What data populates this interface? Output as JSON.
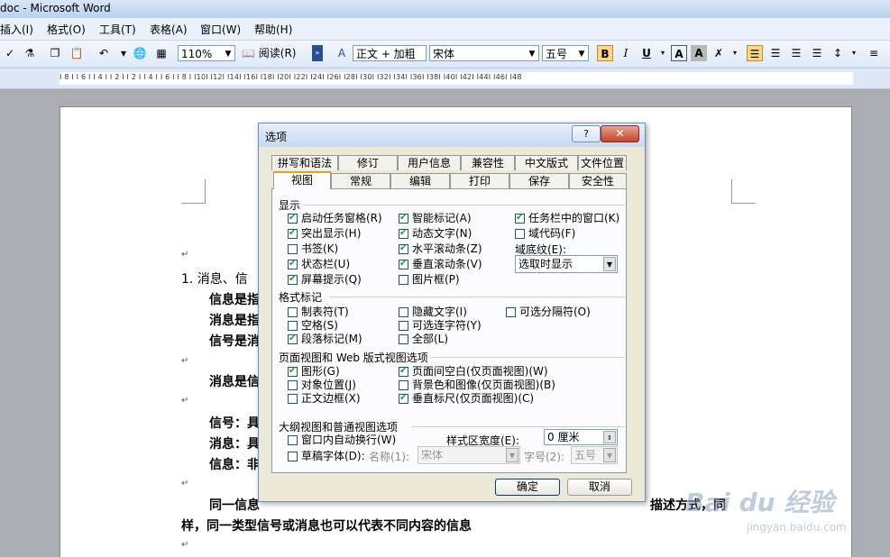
{
  "window": {
    "title": "doc - Microsoft Word"
  },
  "menu": [
    "插入(I)",
    "格式(O)",
    "工具(T)",
    "表格(A)",
    "窗口(W)",
    "帮助(H)"
  ],
  "toolbar": {
    "zoom": "110%",
    "read_label": "阅读(R)",
    "style": "正文 + 加粗",
    "font": "宋体",
    "size": "五号",
    "bold": "B",
    "italic": "I",
    "underline": "U",
    "font_color": "A",
    "char_shade": "A"
  },
  "ruler": {
    "marks": "I 8 I  I 6 I  I 4 I  I 2 I       I 2 I  I 4 I  I 6 I  I 8 I  I10I  I12I  I14I  I16I  I18I  I20I  I22I  I24I  I26I  I28I  I30I  I32I  I34I  I36I  I38I  I40I  I42I  I44I  I46I  I48"
  },
  "document": {
    "line1_prefix": "1. 消息、信",
    "line2": "信息是指",
    "line3": "消息是指",
    "line4": "信号是消",
    "line5": "消息是信",
    "line6": "信号：具",
    "line7": "消息：具",
    "line8": "信息：非",
    "line9_start": "同一信息",
    "line9_end": "描述方式，同",
    "line10": "样，同一类型信号或消息也可以代表不同内容的信息",
    "para_mark": "↵"
  },
  "dialog": {
    "title": "选项",
    "help": "?",
    "close": "✕",
    "tabs_back": [
      "拼写和语法",
      "修订",
      "用户信息",
      "兼容性",
      "中文版式",
      "文件位置"
    ],
    "tabs_front": [
      "视图",
      "常规",
      "编辑",
      "打印",
      "保存",
      "安全性"
    ],
    "show_group": "显示",
    "show_items": [
      {
        "label": "启动任务窗格(R)",
        "checked": true
      },
      {
        "label": "智能标记(A)",
        "checked": true
      },
      {
        "label": "任务栏中的窗口(K)",
        "checked": true
      },
      {
        "label": "突出显示(H)",
        "checked": true
      },
      {
        "label": "动态文字(N)",
        "checked": true
      },
      {
        "label": "域代码(F)",
        "checked": false
      },
      {
        "label": "书签(K)",
        "checked": false
      },
      {
        "label": "水平滚动条(Z)",
        "checked": true
      },
      {
        "label": "状态栏(U)",
        "checked": true
      },
      {
        "label": "垂直滚动条(V)",
        "checked": true
      },
      {
        "label": "屏幕提示(Q)",
        "checked": true
      },
      {
        "label": "图片框(P)",
        "checked": false
      }
    ],
    "field_shading_label": "域底纹(E):",
    "field_shading_value": "选取时显示",
    "format_group": "格式标记",
    "format_items": [
      {
        "label": "制表符(T)",
        "checked": false
      },
      {
        "label": "隐藏文字(I)",
        "checked": false
      },
      {
        "label": "可选分隔符(O)",
        "checked": false
      },
      {
        "label": "空格(S)",
        "checked": false
      },
      {
        "label": "可选连字符(Y)",
        "checked": false
      },
      {
        "label": "段落标记(M)",
        "checked": true
      },
      {
        "label": "全部(L)",
        "checked": false
      }
    ],
    "page_group": "页面视图和 Web 版式视图选项",
    "page_items": [
      {
        "label": "图形(G)",
        "checked": true
      },
      {
        "label": "页面间空白(仅页面视图)(W)",
        "checked": true
      },
      {
        "label": "对象位置(J)",
        "checked": false
      },
      {
        "label": "背景色和图像(仅页面视图)(B)",
        "checked": false
      },
      {
        "label": "正文边框(X)",
        "checked": false
      },
      {
        "label": "垂直标尺(仅页面视图)(C)",
        "checked": true
      }
    ],
    "outline_group": "大纲视图和普通视图选项",
    "wrap_label": "窗口内自动换行(W)",
    "style_width_label": "样式区宽度(E):",
    "style_width_value": "0 厘米",
    "draft_font_label": "草稿字体(D):",
    "name_label": "名称(1):",
    "name_value": "宋体",
    "size_label": "字号(2):",
    "size_value": "五号",
    "ok": "确定",
    "cancel": "取消"
  },
  "watermark": {
    "brand": "Bai du 经验",
    "url": "jingyan.baidu.com"
  },
  "colors": {
    "menu_bg": "#eaf1fb",
    "dialog_bg": "#ece9d8",
    "tab_active_accent": "#e6a31d",
    "close_red": "#c3432a"
  }
}
